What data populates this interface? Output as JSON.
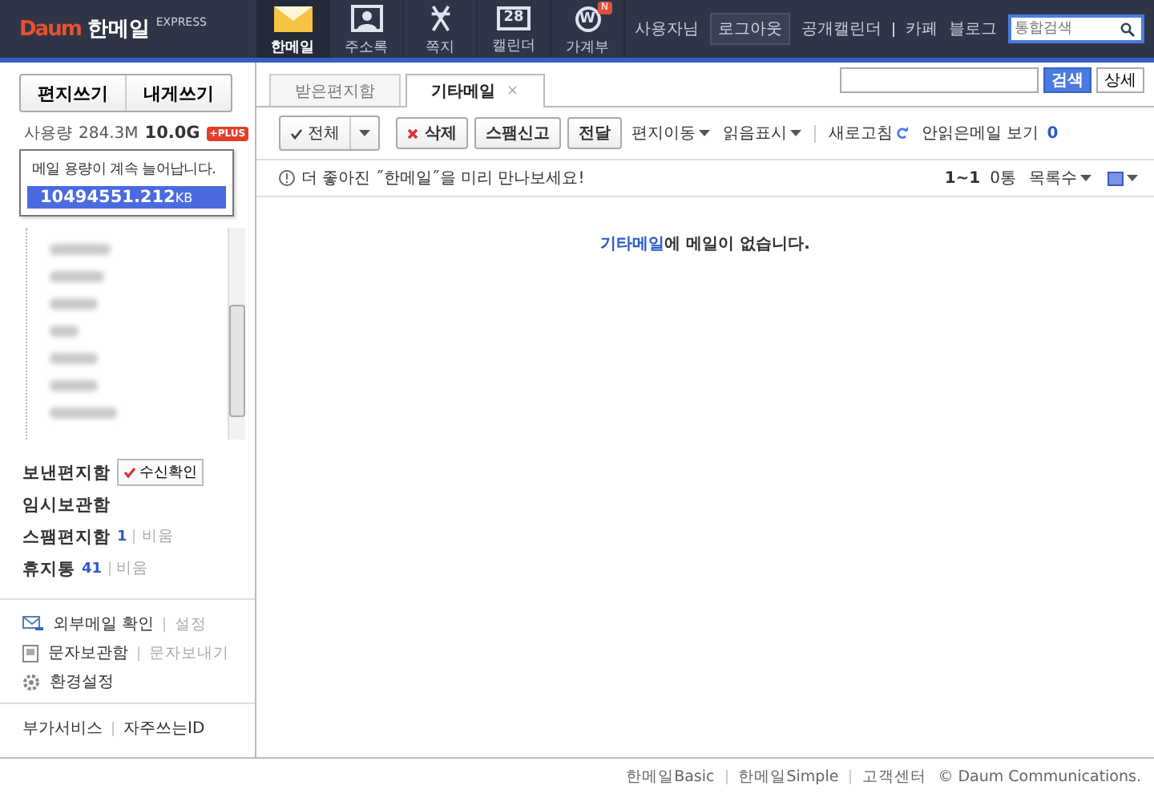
{
  "header": {
    "logo": "Daum",
    "app_name": "한메일",
    "edition": "EXPRESS",
    "nav": [
      {
        "label": "한메일",
        "kind": "envelope",
        "selected": true
      },
      {
        "label": "주소록",
        "kind": "contact",
        "selected": false
      },
      {
        "label": "쪽지",
        "kind": "note",
        "selected": false
      },
      {
        "label": "캘린더",
        "kind": "calendar",
        "icon_text": "28",
        "selected": false
      },
      {
        "label": "가계부",
        "kind": "coin",
        "icon_text": "W",
        "badge": "N",
        "selected": false
      }
    ],
    "user": "사용자님",
    "logout": "로그아웃",
    "links": [
      "공개캘린더",
      "카페",
      "블로그"
    ],
    "search": {
      "placeholder": "통합검색"
    }
  },
  "sidebar": {
    "compose": [
      "편지쓰기",
      "내게쓰기"
    ],
    "usage_label": "사용량",
    "usage": "284.3M",
    "quota": "10.0G",
    "plus": "+PLUS",
    "popup": {
      "message": "메일 용량이 계속 늘어납니다.",
      "value": "10494551.212",
      "unit": "KB"
    },
    "folders": [
      {
        "name": "보낸편지함",
        "button": "수신확인"
      },
      {
        "name": "임시보관함"
      },
      {
        "name": "스팸편지함",
        "count": "1",
        "action": "비움"
      },
      {
        "name": "휴지통",
        "count": "41",
        "action": "비움"
      }
    ],
    "tools": [
      {
        "kind": "mail",
        "label": "외부메일 확인",
        "action": "설정"
      },
      {
        "kind": "message",
        "label": "문자보관함",
        "action": "문자보내기"
      },
      {
        "kind": "settings",
        "label": "환경설정"
      }
    ],
    "links": [
      "부가서비스",
      "자주쓰는ID"
    ]
  },
  "main": {
    "tabs": [
      {
        "label": "받은편지함",
        "selected": false
      },
      {
        "label": "기타메일",
        "selected": true,
        "close": "×"
      }
    ],
    "search_button": "검색",
    "detail_button": "상세",
    "toolbar": [
      {
        "kind": "split",
        "label": "전체"
      },
      {
        "kind": "delete",
        "label": "삭제"
      },
      {
        "kind": "button",
        "label": "스팸신고"
      },
      {
        "kind": "button",
        "label": "전달"
      },
      {
        "kind": "menu",
        "label": "편지이동"
      },
      {
        "kind": "menu",
        "label": "읽음표시"
      },
      {
        "kind": "refresh",
        "label": "새로고침"
      },
      {
        "kind": "count",
        "label": "안읽은메일 보기",
        "count": "0"
      }
    ],
    "notice_icon": "!",
    "notice": "더 좋아진 ˝한메일˝을 미리 만나보세요!",
    "range": "1~1",
    "total": "0통",
    "page_size": "목록수",
    "empty": {
      "link": "기타메일",
      "text": "에 메일이 없습니다."
    }
  },
  "footer": [
    "한메일Basic",
    "한메일Simple",
    "고객센터",
    "© Daum Communications."
  ]
}
